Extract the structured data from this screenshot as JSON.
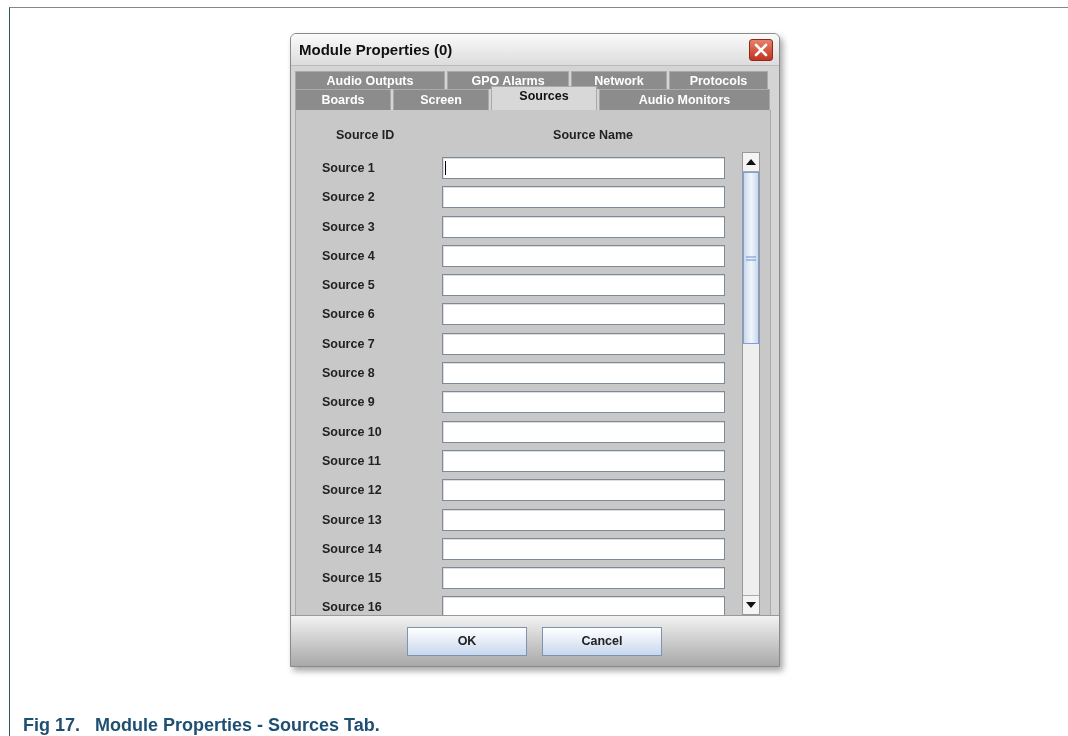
{
  "dialog": {
    "title": "Module Properties (0)",
    "tab_rows": [
      [
        {
          "label": "Audio Outputs",
          "selected": false
        },
        {
          "label": "GPO Alarms",
          "selected": false
        },
        {
          "label": "Network",
          "selected": false
        },
        {
          "label": "Protocols",
          "selected": false
        }
      ],
      [
        {
          "label": "Boards",
          "selected": false
        },
        {
          "label": "Screen",
          "selected": false
        },
        {
          "label": "Sources",
          "selected": true
        },
        {
          "label": "Audio Monitors",
          "selected": false
        }
      ]
    ],
    "columns": [
      "Source ID",
      "Source Name"
    ],
    "rows": [
      {
        "label": "Source 1",
        "focused": true
      },
      {
        "label": "Source 2",
        "focused": false
      },
      {
        "label": "Source 3",
        "focused": false
      },
      {
        "label": "Source 4",
        "focused": false
      },
      {
        "label": "Source 5",
        "focused": false
      },
      {
        "label": "Source 6",
        "focused": false
      },
      {
        "label": "Source 7",
        "focused": false
      },
      {
        "label": "Source 8",
        "focused": false
      },
      {
        "label": "Source 9",
        "focused": false
      },
      {
        "label": "Source 10",
        "focused": false
      },
      {
        "label": "Source 11",
        "focused": false
      },
      {
        "label": "Source 12",
        "focused": false
      },
      {
        "label": "Source 13",
        "focused": false
      },
      {
        "label": "Source 14",
        "focused": false
      },
      {
        "label": "Source 15",
        "focused": false
      },
      {
        "label": "Source 16",
        "focused": false
      }
    ],
    "buttons": [
      "OK",
      "Cancel"
    ]
  },
  "caption": "Fig 17.   Module Properties - Sources Tab."
}
